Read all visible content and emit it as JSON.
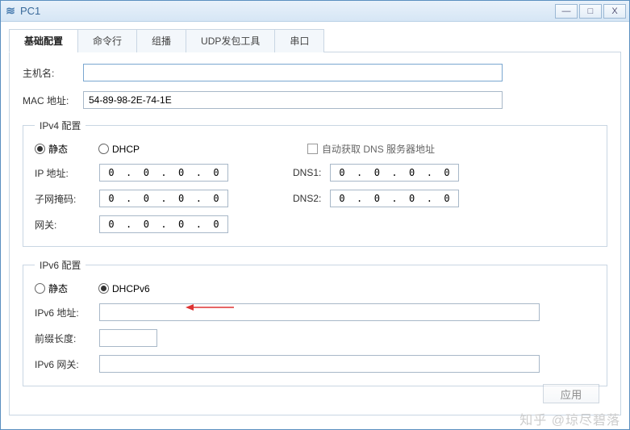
{
  "window": {
    "title": "PC1"
  },
  "tabs": {
    "basic": "基础配置",
    "cli": "命令行",
    "multicast": "组播",
    "udp": "UDP发包工具",
    "serial": "串口"
  },
  "basic": {
    "hostname_label": "主机名:",
    "hostname_value": "",
    "mac_label": "MAC 地址:",
    "mac_value": "54-89-98-2E-74-1E"
  },
  "ipv4": {
    "legend": "IPv4 配置",
    "static_label": "静态",
    "dhcp_label": "DHCP",
    "auto_dns_label": "自动获取 DNS 服务器地址",
    "ip_label": "IP 地址:",
    "ip_value": "0  .  0  .  0  .  0",
    "mask_label": "子网掩码:",
    "mask_value": "0  .  0  .  0  .  0",
    "gw_label": "网关:",
    "gw_value": "0  .  0  .  0  .  0",
    "dns1_label": "DNS1:",
    "dns1_value": "0  .  0  .  0  .  0",
    "dns2_label": "DNS2:",
    "dns2_value": "0  .  0  .  0  .  0",
    "mode_selected": "static"
  },
  "ipv6": {
    "legend": "IPv6 配置",
    "static_label": "静态",
    "dhcpv6_label": "DHCPv6",
    "addr_label": "IPv6 地址:",
    "addr_value": "",
    "prefix_label": "前缀长度:",
    "prefix_value": "",
    "gw_label": "IPv6 网关:",
    "gw_value": "",
    "mode_selected": "dhcpv6"
  },
  "buttons": {
    "apply": "应用"
  },
  "watermark": "知乎 @琼尽碧落"
}
